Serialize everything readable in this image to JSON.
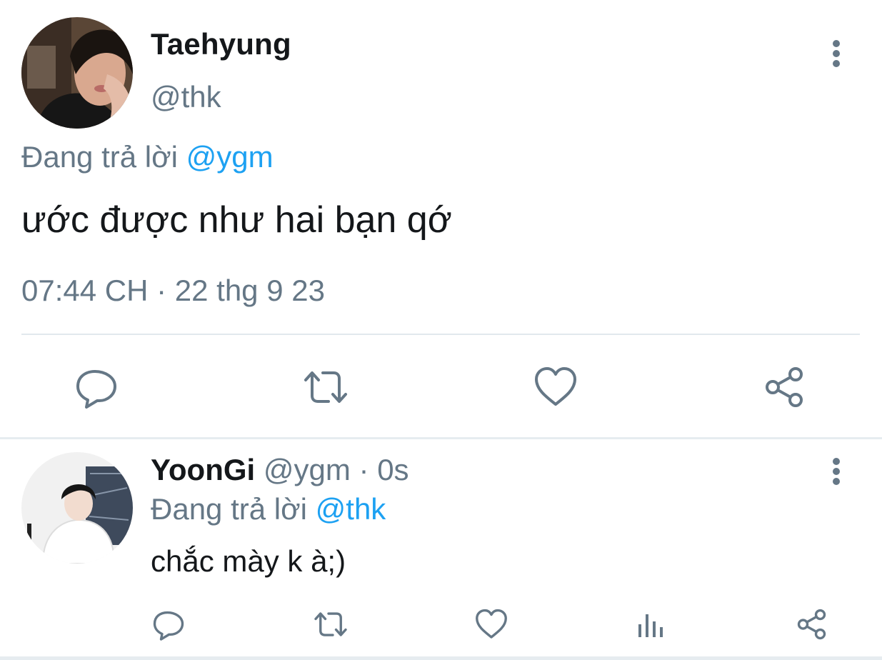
{
  "main_tweet": {
    "display_name": "Taehyung",
    "handle": "@thk",
    "replying_prefix": "Đang trả lời",
    "replying_to": "@ygm",
    "text": "ước được như hai bạn qớ",
    "timestamp": "07:44 CH · 22 thg 9 23",
    "actions": [
      "reply-icon",
      "retweet-icon",
      "like-icon",
      "share-icon"
    ]
  },
  "reply_tweet": {
    "display_name": "YoonGi",
    "handle": "@ygm",
    "separator": " · ",
    "time_ago": "0s",
    "replying_prefix": "Đang trả lời",
    "replying_to": "@thk",
    "text": "chắc mày k à;)",
    "actions": [
      "reply-icon",
      "retweet-icon",
      "like-icon",
      "analytics-icon",
      "share-icon"
    ]
  },
  "colors": {
    "text_primary": "#14171a",
    "text_secondary": "#657786",
    "accent": "#1da1f2",
    "icon": "#657786",
    "divider": "#e1e8ed"
  }
}
